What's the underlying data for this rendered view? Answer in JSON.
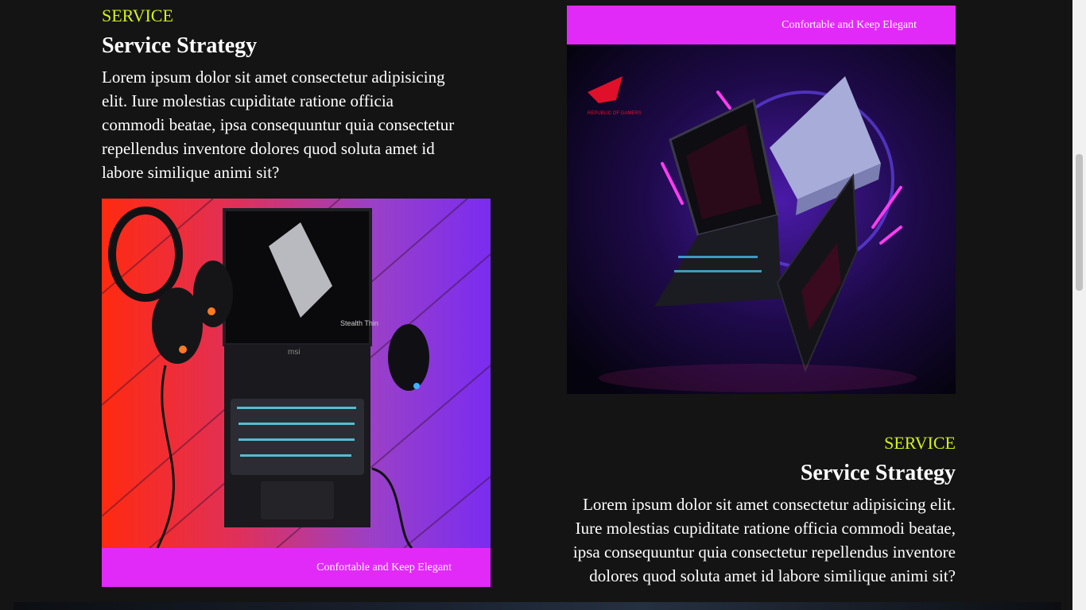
{
  "section1": {
    "kicker": "SERVICE",
    "title": "Service Strategy",
    "text": "Lorem ipsum dolor sit amet consectetur adipisicing elit. Iure molestias cupiditate ratione officia commodi beatae, ipsa consequuntur quia consectetur repellendus inventore dolores quod soluta amet id labore similique animi sit?",
    "image_caption": "Confortable and Keep Elegant",
    "image_logo_text": "msi",
    "screen_text": "Stealth Thin"
  },
  "section2": {
    "kicker": "SERVICE",
    "title": "Service Strategy",
    "text": "Lorem ipsum dolor sit amet consectetur adipisicing elit. Iure molestias cupiditate ratione officia commodi beatae, ipsa consequuntur quia consectetur repellendus inventore dolores quod soluta amet id labore similique animi sit?",
    "image_caption": "Confortable and Keep Elegant",
    "brand_text": "REPUBLIC OF GAMERS"
  },
  "colors": {
    "accent": "#d4f217",
    "banner": "#e22af8",
    "background": "#141414"
  }
}
